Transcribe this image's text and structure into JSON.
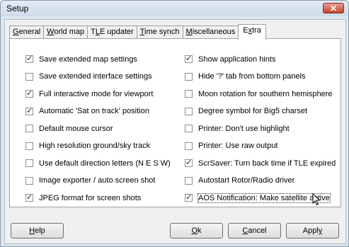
{
  "window": {
    "title": "Setup",
    "close_glyph": "✕"
  },
  "tabs": [
    {
      "label": "General",
      "mnemonic": "G",
      "rest": "eneral",
      "active": false
    },
    {
      "label": "World map",
      "mnemonic": "W",
      "rest": "orld map",
      "active": false
    },
    {
      "label": "TLE updater",
      "pre": "T",
      "mnemonic": "L",
      "rest": "E updater",
      "active": false
    },
    {
      "label": "Time synch",
      "mnemonic": "T",
      "rest": "ime synch",
      "active": false
    },
    {
      "label": "Miscellaneous",
      "mnemonic": "M",
      "rest": "iscellaneous",
      "active": false
    },
    {
      "label": "Extra",
      "pre": "E",
      "mnemonic": "x",
      "rest": "tra",
      "active": true
    }
  ],
  "options_left": [
    {
      "label": "Save extended map settings",
      "checked": true
    },
    {
      "label": "Save extended interface settings",
      "checked": false
    },
    {
      "label": "Full interactive mode for viewport",
      "checked": true
    },
    {
      "label": "Automatic 'Sat on track' position",
      "checked": true
    },
    {
      "label": "Default mouse cursor",
      "checked": false
    },
    {
      "label": "High resolution ground/sky track",
      "checked": false
    },
    {
      "label": "Use default direction letters (N E S W)",
      "checked": false
    },
    {
      "label": "Image exporter / auto screen shot",
      "checked": false
    },
    {
      "label": "JPEG format for screen shots",
      "checked": true
    }
  ],
  "options_right": [
    {
      "label": "Show application hints",
      "checked": true
    },
    {
      "label": "Hide '?' tab from bottom panels",
      "checked": false
    },
    {
      "label": "Moon rotation for southern hemisphere",
      "checked": false
    },
    {
      "label": "Degree symbol for Big5 charset",
      "checked": false
    },
    {
      "label": "Printer: Don't use highlight",
      "checked": false
    },
    {
      "label": "Printer: Use raw output",
      "checked": false
    },
    {
      "label": "ScrSaver: Turn back time if TLE expired",
      "checked": true
    },
    {
      "label": "Autostart Rotor/Radio driver",
      "checked": false
    },
    {
      "label": "AOS Notification: Make satellite active",
      "checked": true,
      "focused": true
    }
  ],
  "buttons": {
    "help": {
      "mnemonic": "H",
      "rest": "elp"
    },
    "ok": {
      "mnemonic": "O",
      "rest": "k"
    },
    "cancel": {
      "mnemonic": "C",
      "rest": "ancel"
    },
    "apply": {
      "pre": "Appl",
      "mnemonic": "y",
      "rest": ""
    }
  }
}
